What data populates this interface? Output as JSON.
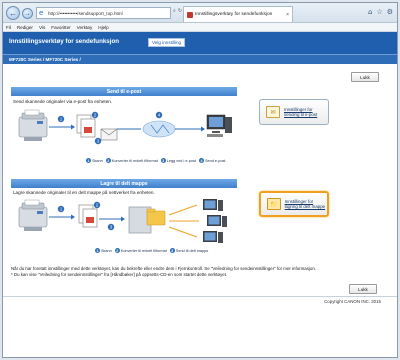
{
  "browser": {
    "url": "http://•••••••••••/sendsupport_top.html",
    "tab_title": "Innstillingsverktøy for sendefunksjon",
    "tab_close": "×",
    "back_glyph": "←",
    "forward_glyph": "→",
    "window_icons": [
      "⌂",
      "☆",
      "⚙"
    ],
    "menu": [
      "Fil",
      "Rediger",
      "Vis",
      "Favoritter",
      "Verktøy",
      "Hjelp"
    ]
  },
  "header": {
    "title": "Innstillingsverktøy for sendefunksjon",
    "language_button": "Velg innstilling"
  },
  "subheader": {
    "model": "MF720C Series / MF720C Series /"
  },
  "close_label": "Lukk",
  "email_section": {
    "title": "Send til e-post",
    "description": "Send skannede originaler via e-post fra enheten.",
    "steps": [
      {
        "n": "1",
        "label": "Skann"
      },
      {
        "n": "2",
        "label": "Konverter til enkelt filformat"
      },
      {
        "n": "3",
        "label": "Legg ved i e-post"
      },
      {
        "n": "4",
        "label": "Send e-post"
      }
    ],
    "card_label": "Innstillinger for sending til e-post",
    "card_icon": "✉"
  },
  "folder_section": {
    "title": "Lagre til delt mappe",
    "description": "Lagre skannede originaler til en delt mappe på nettverket fra enheten.",
    "steps": [
      {
        "n": "1",
        "label": "Skann"
      },
      {
        "n": "2",
        "label": "Konverter til enkelt filformat"
      },
      {
        "n": "3",
        "label": "Send til delt mappe"
      }
    ],
    "card_label": "Innstillinger for lagring til delt mappe",
    "card_icon": "📁"
  },
  "info": {
    "line1": "Når du har foretatt innstillinger med dette verktøyet, kan du bekrefte eller endre dem i Fjernkontroll. Se \"Veiledning for sendeinnstillinger\" for mer informasjon.",
    "line2": "* Du kan vise \"Veiledning for sendeinnstillinger\" fra [Håndbøker] på oppsetts-CD-en som startet dette verktøyet."
  },
  "footer": {
    "copyright": "Copyright CANON INC. 2015"
  },
  "colors": {
    "header": "#1f5fae",
    "section_bar": "#3f80cc",
    "step_badge": "#2f6db8",
    "selected_outline": "#f0a020"
  }
}
